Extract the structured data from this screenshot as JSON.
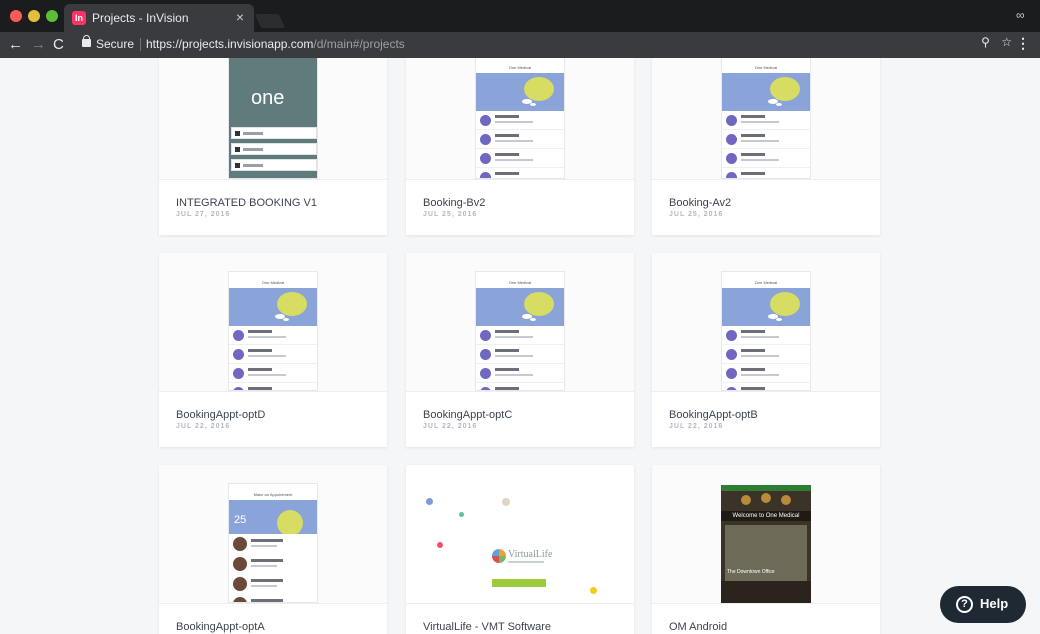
{
  "browser": {
    "tab_title": "Projects - InVision",
    "tab_favicon": "In",
    "tab_close": "×",
    "secure_label": "Secure",
    "url_host": "https://projects.invisionapp.com",
    "url_path": "/d/main#/projects",
    "back_glyph": "←",
    "forward_glyph": "→",
    "reload_glyph": "C",
    "zoom_glyph": "⚲",
    "star_glyph": "☆",
    "menu_glyph": "⋮",
    "incognito_glyph": "∞"
  },
  "projects": [
    {
      "title": "INTEGRATED BOOKING V1",
      "date": "JUL 27, 2016",
      "thumb": "one-login"
    },
    {
      "title": "Booking-Bv2",
      "date": "JUL 25, 2016",
      "thumb": "one-medical-list"
    },
    {
      "title": "Booking-Av2",
      "date": "JUL 25, 2016",
      "thumb": "one-medical-list"
    },
    {
      "title": "BookingAppt-optD",
      "date": "JUL 22, 2016",
      "thumb": "one-medical-list"
    },
    {
      "title": "BookingAppt-optC",
      "date": "JUL 22, 2016",
      "thumb": "one-medical-list"
    },
    {
      "title": "BookingAppt-optB",
      "date": "JUL 22, 2016",
      "thumb": "one-medical-list"
    },
    {
      "title": "BookingAppt-optA",
      "date": "",
      "thumb": "make-appointment"
    },
    {
      "title": "VirtualLife - VMT Software",
      "date": "",
      "thumb": "virtuallife"
    },
    {
      "title": "OM Android",
      "date": "",
      "thumb": "android"
    }
  ],
  "thumb_text": {
    "one_logo": "one",
    "one_medical": "One Medical",
    "make_appt": "Make an Appointment",
    "appt_date": "25",
    "virtuallife": "VirtualLife",
    "android_welcome": "Welcome to One Medical",
    "android_photo": "The Downtown Office"
  },
  "help": {
    "label": "Help",
    "icon": "?"
  },
  "colors": {
    "accent": "#ff3366",
    "hero": "#8aa3d8",
    "sun": "#d7dc62",
    "dot": "#7067c1",
    "help_bg": "#1f2933"
  }
}
